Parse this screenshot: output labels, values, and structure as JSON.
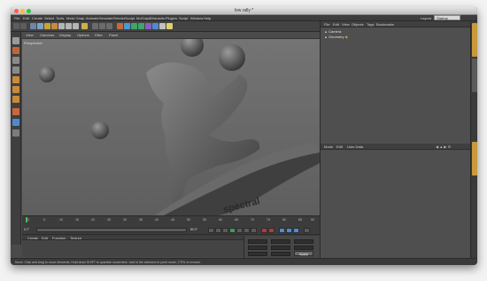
{
  "window": {
    "title": "low rally *",
    "layout_label": "Layout",
    "layout_value": "Startup"
  },
  "menu": [
    "File",
    "Edit",
    "Create",
    "Select",
    "Tools",
    "Mesh",
    "Snap",
    "Animate",
    "Simulate",
    "Render",
    "Sculpt",
    "MoGraph",
    "Character",
    "Plugins",
    "Script",
    "Window",
    "Help"
  ],
  "viewport": {
    "menu": [
      "View",
      "Cameras",
      "Display",
      "Options",
      "Filter",
      "Panel"
    ],
    "label": "Perspective",
    "watermark": "spectral"
  },
  "timeline": {
    "ticks": [
      "0",
      "5",
      "10",
      "15",
      "20",
      "25",
      "30",
      "35",
      "40",
      "45",
      "50",
      "55",
      "60",
      "65",
      "70",
      "75",
      "80",
      "85",
      "90"
    ],
    "start_frame": "0 F",
    "end_frame": "90 F",
    "current_frame": "0 F"
  },
  "materials": {
    "menu": [
      "Create",
      "Edit",
      "Function",
      "Texture"
    ]
  },
  "coordinates": {
    "apply_label": "Apply"
  },
  "object_manager": {
    "menu": [
      "File",
      "Edit",
      "View",
      "Objects",
      "Tags",
      "Bookmarks"
    ],
    "objects": [
      {
        "name": "Camera",
        "tag": "camera"
      },
      {
        "name": "Geometry",
        "tag": "null"
      }
    ]
  },
  "attributes": {
    "menu": [
      "Mode",
      "Edit",
      "User Data"
    ]
  },
  "status": "Move: Click and drag to move elements. Hold down SHIFT to quantize movement / add to the selection in point mode, CTRL to remove."
}
